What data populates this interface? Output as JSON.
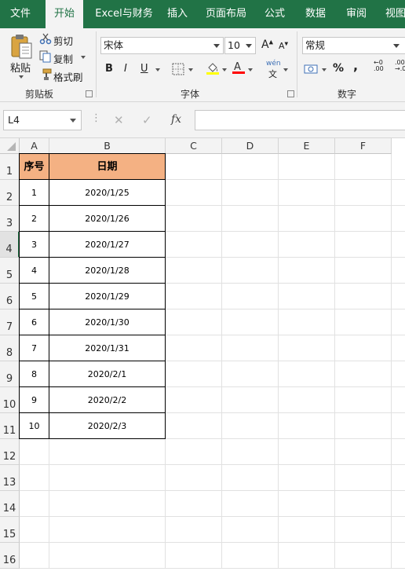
{
  "ribbon_tabs": [
    "文件",
    "开始",
    "Excel与财务",
    "插入",
    "页面布局",
    "公式",
    "数据",
    "审阅",
    "视图"
  ],
  "clipboard": {
    "paste": "粘贴",
    "cut": "剪切",
    "copy": "复制",
    "format_painter": "格式刷",
    "label": "剪贴板"
  },
  "font": {
    "name": "宋体",
    "size": "10",
    "bold": "B",
    "italic": "I",
    "underline": "U",
    "label": "字体",
    "phonetic_top": "wén",
    "phonetic_bottom": "文"
  },
  "number": {
    "format": "常规",
    "percent": "%",
    "comma": ",",
    "label": "数字"
  },
  "formula_bar": {
    "name_box": "L4",
    "fx": "fx",
    "cancel": "✕",
    "enter": "✓",
    "value": ""
  },
  "sheet": {
    "columns": [
      "A",
      "B",
      "C",
      "D",
      "E",
      "F"
    ],
    "rows": [
      "1",
      "2",
      "3",
      "4",
      "5",
      "6",
      "7",
      "8",
      "9",
      "10",
      "11",
      "12",
      "13",
      "14",
      "15",
      "16"
    ],
    "selected_row": "4",
    "table_header": [
      "序号",
      "日期"
    ],
    "table_rows": [
      [
        "1",
        "2020/1/25"
      ],
      [
        "2",
        "2020/1/26"
      ],
      [
        "3",
        "2020/1/27"
      ],
      [
        "4",
        "2020/1/28"
      ],
      [
        "5",
        "2020/1/29"
      ],
      [
        "6",
        "2020/1/30"
      ],
      [
        "7",
        "2020/1/31"
      ],
      [
        "8",
        "2020/2/1"
      ],
      [
        "9",
        "2020/2/2"
      ],
      [
        "10",
        "2020/2/3"
      ]
    ],
    "header_fill": "#f4b183"
  },
  "colors": {
    "excel_green": "#217346",
    "font_color": "#ff0000",
    "fill_color": "#ffff00"
  }
}
